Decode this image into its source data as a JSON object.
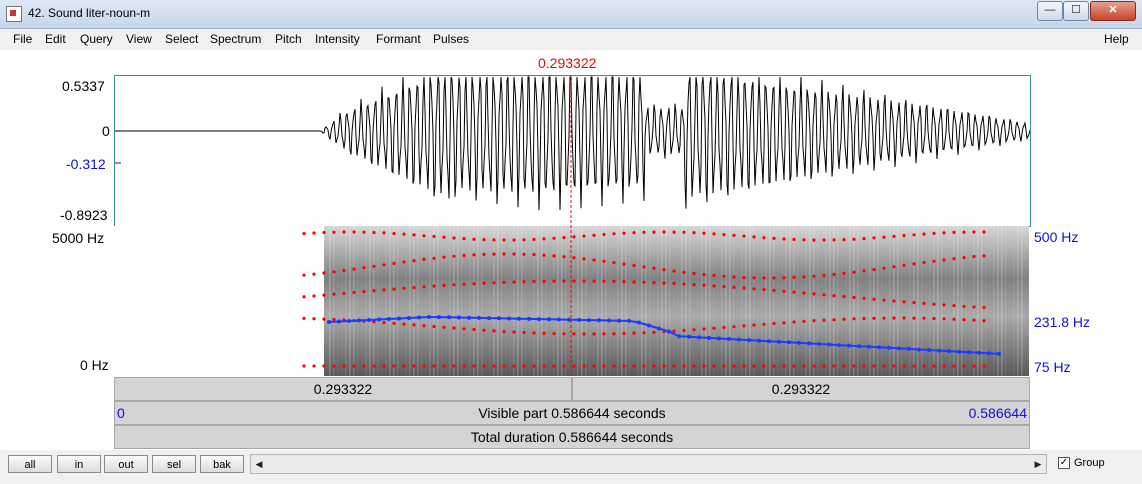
{
  "window": {
    "title": "42. Sound liter-noun-m",
    "min": "—",
    "max": "☐",
    "close": "✕"
  },
  "menu": {
    "items": [
      "File",
      "Edit",
      "Query",
      "View",
      "Select",
      "Spectrum",
      "Pitch",
      "Intensity",
      "Formant",
      "Pulses"
    ],
    "help": "Help"
  },
  "cursor": {
    "time_label": "0.293322",
    "time": 0.293322
  },
  "waveform": {
    "y_top": "0.5337",
    "y_zero": "0",
    "y_cursor": "-0.312",
    "y_bottom": "-0.8923"
  },
  "spectrogram": {
    "freq_top": "5000 Hz",
    "freq_bottom": "0 Hz",
    "pitch_top": "500 Hz",
    "pitch_value": "231.8 Hz",
    "pitch_bottom": "75 Hz"
  },
  "bars": {
    "left_segment": "0.293322",
    "right_segment": "0.293322",
    "visible_start": "0",
    "visible_label": "Visible part 0.586644 seconds",
    "visible_end": "0.586644",
    "total_label": "Total duration 0.586644 seconds"
  },
  "bottom": {
    "buttons": [
      "all",
      "in",
      "out",
      "sel",
      "bak"
    ],
    "group_label": "Group",
    "scroll_left": "◀",
    "scroll_right": "▶"
  },
  "colors": {
    "pitch": "#1a3cff",
    "formant": "#ff0000",
    "cursor": "#d01010",
    "axis_blue": "#1010d0"
  }
}
